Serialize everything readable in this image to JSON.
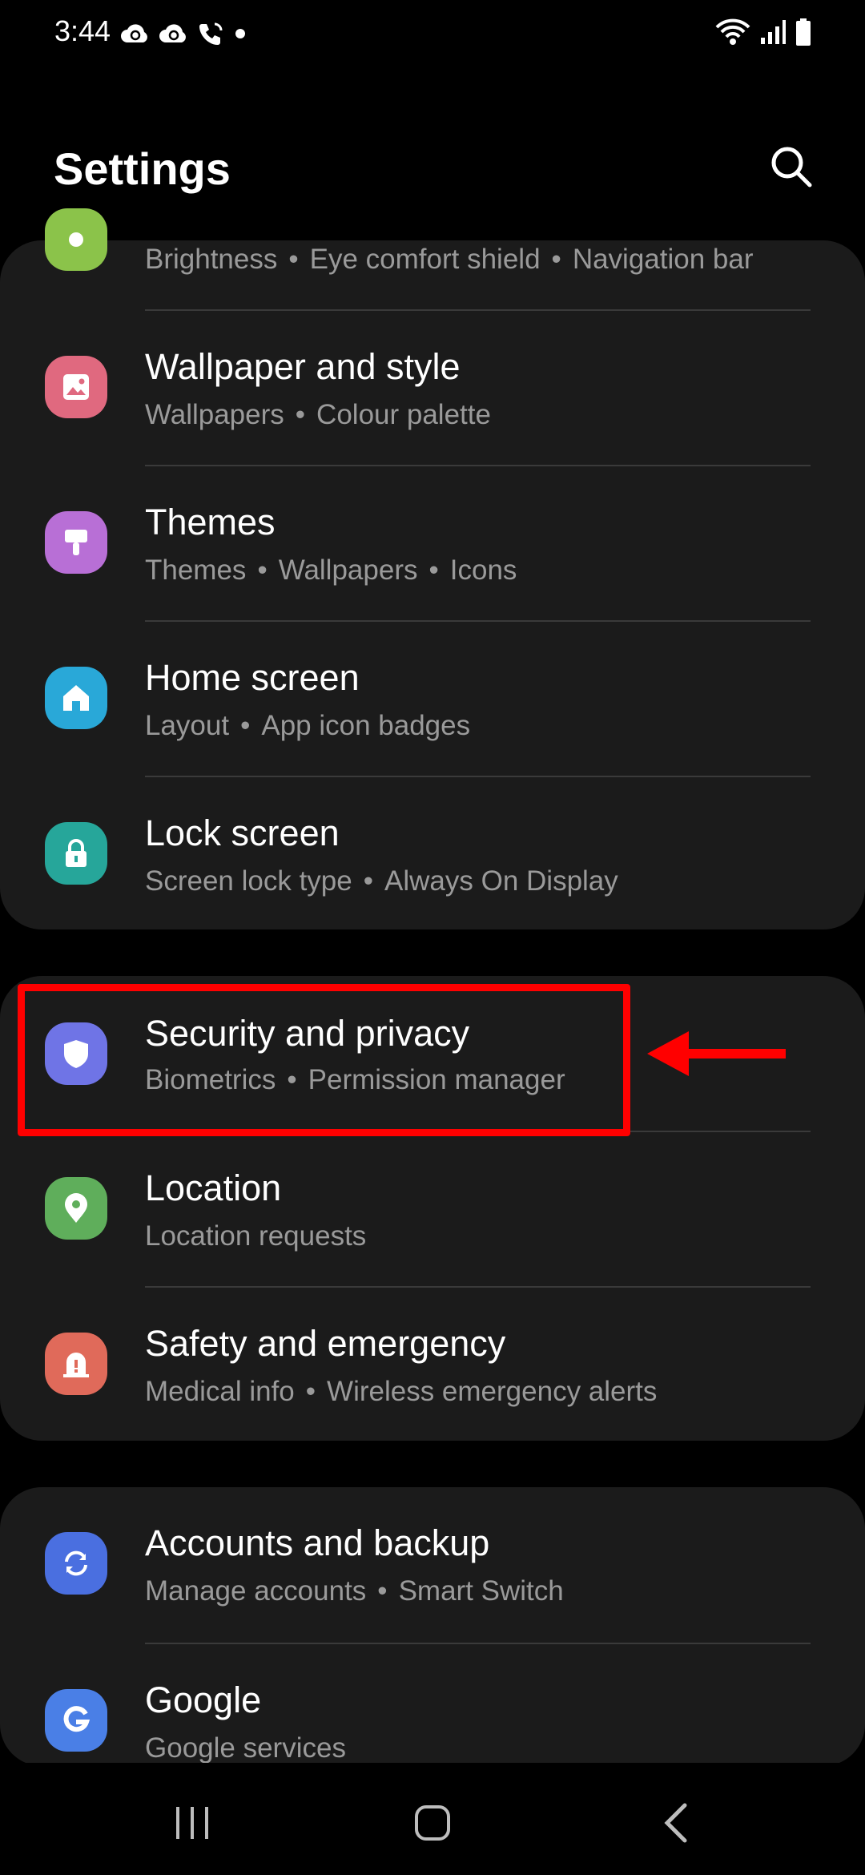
{
  "status_bar": {
    "time": "3:44"
  },
  "header": {
    "title": "Settings"
  },
  "colors": {
    "background": "#000000",
    "card": "#1b1b1b",
    "title_text": "#ffffff",
    "subtitle_text": "#9a9a9a",
    "highlight": "#ff0000"
  },
  "groups": [
    {
      "items": [
        {
          "title": "",
          "subtitle": [
            "Brightness",
            "Eye comfort shield",
            "Navigation bar"
          ],
          "icon": "display-icon",
          "icon_color": "#8bc34a"
        },
        {
          "title": "Wallpaper and style",
          "subtitle": [
            "Wallpapers",
            "Colour palette"
          ],
          "icon": "wallpaper-icon",
          "icon_color": "#e0697f"
        },
        {
          "title": "Themes",
          "subtitle": [
            "Themes",
            "Wallpapers",
            "Icons"
          ],
          "icon": "brush-icon",
          "icon_color": "#b86fd6"
        },
        {
          "title": "Home screen",
          "subtitle": [
            "Layout",
            "App icon badges"
          ],
          "icon": "home-icon",
          "icon_color": "#29a8d8"
        },
        {
          "title": "Lock screen",
          "subtitle": [
            "Screen lock type",
            "Always On Display"
          ],
          "icon": "lock-icon",
          "icon_color": "#26a69a"
        }
      ]
    },
    {
      "items": [
        {
          "title": "Security and privacy",
          "subtitle": [
            "Biometrics",
            "Permission manager"
          ],
          "icon": "shield-icon",
          "icon_color": "#6f74e6"
        },
        {
          "title": "Location",
          "subtitle": [
            "Location requests"
          ],
          "icon": "location-pin-icon",
          "icon_color": "#5fae5b"
        },
        {
          "title": "Safety and emergency",
          "subtitle": [
            "Medical info",
            "Wireless emergency alerts"
          ],
          "icon": "emergency-icon",
          "icon_color": "#e06a5a"
        }
      ]
    },
    {
      "items": [
        {
          "title": "Accounts and backup",
          "subtitle": [
            "Manage accounts",
            "Smart Switch"
          ],
          "icon": "sync-icon",
          "icon_color": "#4a6fe0"
        },
        {
          "title": "Google",
          "subtitle": [
            "Google services"
          ],
          "icon": "google-icon",
          "icon_color": "#4a7fe6"
        }
      ]
    }
  ]
}
